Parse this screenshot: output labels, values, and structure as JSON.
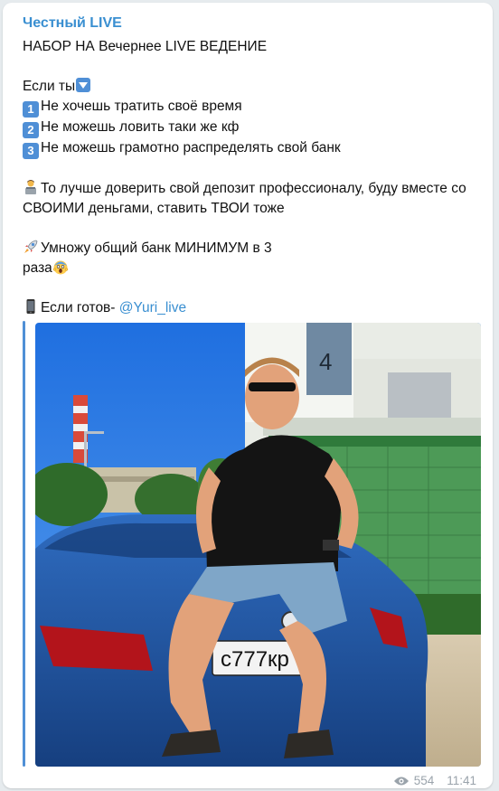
{
  "channel": {
    "name": "Честный LIVE"
  },
  "post": {
    "headline": "НАБОР НА Вечернее LIVE ВЕДЕНИЕ",
    "intro": "Если ты",
    "items": [
      {
        "number": "1",
        "text": "Не хочешь тратить своё время"
      },
      {
        "number": "2",
        "text": "Не можешь ловить таки же кф"
      },
      {
        "number": "3",
        "text": "Не можешь грамотно распределять свой банк"
      }
    ],
    "pitch_1": "То лучше доверить свой депозит профессионалу, буду вместе со СВОИМИ деньгами, ставить ТВОИ тоже",
    "pitch_2_line1": "Умножу общий банк МИНИМУМ в 3",
    "pitch_2_line2": "раза",
    "cta": "Если готов-",
    "contact_handle": "@Yuri_live"
  },
  "photo": {
    "plate_text": "с777кр"
  },
  "meta": {
    "views": "554",
    "time": "11:41"
  },
  "icons": {
    "down_arrow": "down-arrow-emoji-icon",
    "number_keycap": "keycap-icon",
    "person_laptop": "person-at-computer-emoji-icon",
    "rocket": "rocket-emoji-icon",
    "scream": "screaming-face-emoji-icon",
    "phone": "mobile-phone-emoji-icon",
    "eye": "eye-icon"
  },
  "colors": {
    "accent": "#3a8fd1",
    "background": "#e6ebee",
    "bubble": "#ffffff",
    "meta": "#9aa3ab",
    "keycap": "#4f8fd6"
  }
}
